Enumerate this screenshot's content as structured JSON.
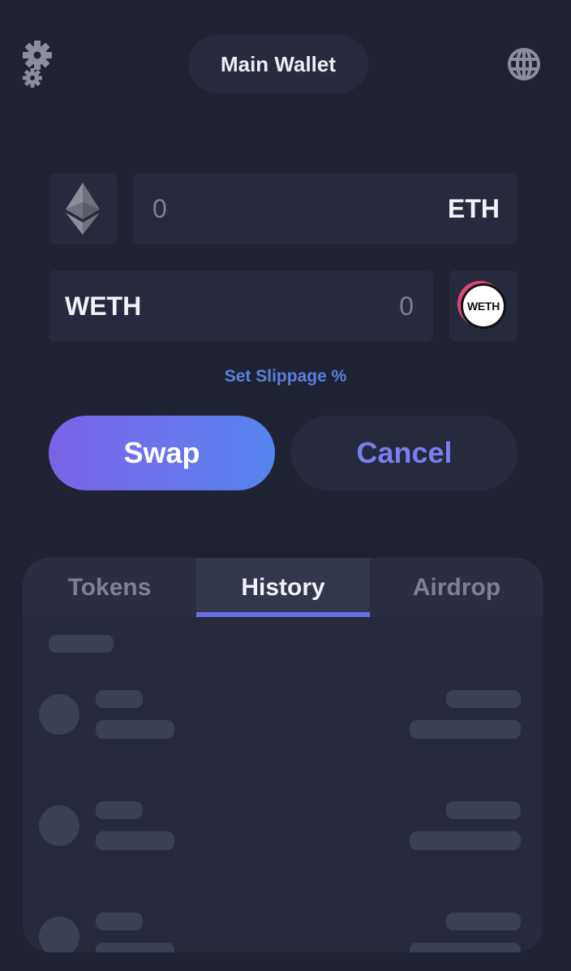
{
  "header": {
    "settings_icon": "gears-icon",
    "wallet_name": "Main Wallet",
    "network_icon": "globe-icon"
  },
  "swap": {
    "from": {
      "amount": "0",
      "symbol": "ETH",
      "icon": "ethereum-icon"
    },
    "to": {
      "amount": "0",
      "symbol": "WETH",
      "icon": "weth-icon",
      "logo_text": "WETH"
    },
    "slippage_label": "Set Slippage %",
    "swap_label": "Swap",
    "cancel_label": "Cancel"
  },
  "tabs": [
    {
      "label": "Tokens",
      "active": false
    },
    {
      "label": "History",
      "active": true
    },
    {
      "label": "Airdrop",
      "active": false
    }
  ],
  "history": {
    "state": "loading-skeleton",
    "rows": 3
  },
  "colors": {
    "background": "#1f2233",
    "panel": "#272a3c",
    "accent": "#6c6fe6",
    "swap_gradient_start": "#7b63e6",
    "swap_gradient_end": "#5485ee",
    "link": "#5a7fdc"
  }
}
